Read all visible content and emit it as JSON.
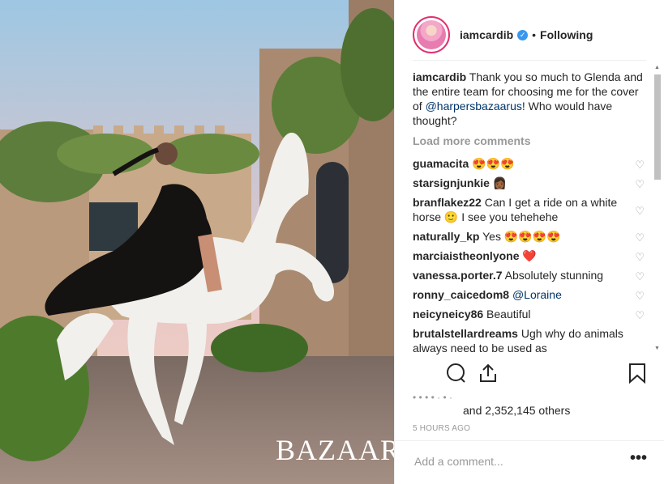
{
  "post": {
    "username": "iamcardib",
    "verified_icon": "verified-icon",
    "separator": "•",
    "follow_status": "Following",
    "photo_overlay_text": "BAZAAR",
    "caption": {
      "username": "iamcardib",
      "text_before": " Thank you so much to Glenda and the entire team for choosing me for the cover of ",
      "mention": "@harpersbazaarus",
      "text_after": "! Who would have thought?"
    },
    "load_more": "Load more comments",
    "comments": [
      {
        "user": "guamacita",
        "text": " 😍😍😍",
        "mention": ""
      },
      {
        "user": "starsignjunkie",
        "text": " 👩🏾",
        "mention": ""
      },
      {
        "user": "branflakez22",
        "text": " Can I get a ride on a white horse 🙂 I see you tehehehe",
        "mention": ""
      },
      {
        "user": "naturally_kp",
        "text": " Yes 😍😍😍😍",
        "mention": ""
      },
      {
        "user": "marciaistheonlyone",
        "text": " ❤️",
        "mention": ""
      },
      {
        "user": "vanessa.porter.7",
        "text": " Absolutely stunning",
        "mention": ""
      },
      {
        "user": "ronny_caicedom8",
        "text": " ",
        "mention": "@Loraine"
      },
      {
        "user": "neicyneicy86",
        "text": " Beautiful",
        "mention": ""
      },
      {
        "user": "brutalstellardreams",
        "text": " Ugh why do animals always need to be used as",
        "mention": ""
      }
    ],
    "likes": {
      "text": "and 2,352,145 others"
    },
    "timestamp": "5 HOURS AGO",
    "add_comment_placeholder": "Add a comment...",
    "more_icon_glyph": "•••"
  },
  "colors": {
    "accent_link": "#003569",
    "verified": "#3897f0",
    "muted": "#999999",
    "heart_red": "#ed4956"
  }
}
